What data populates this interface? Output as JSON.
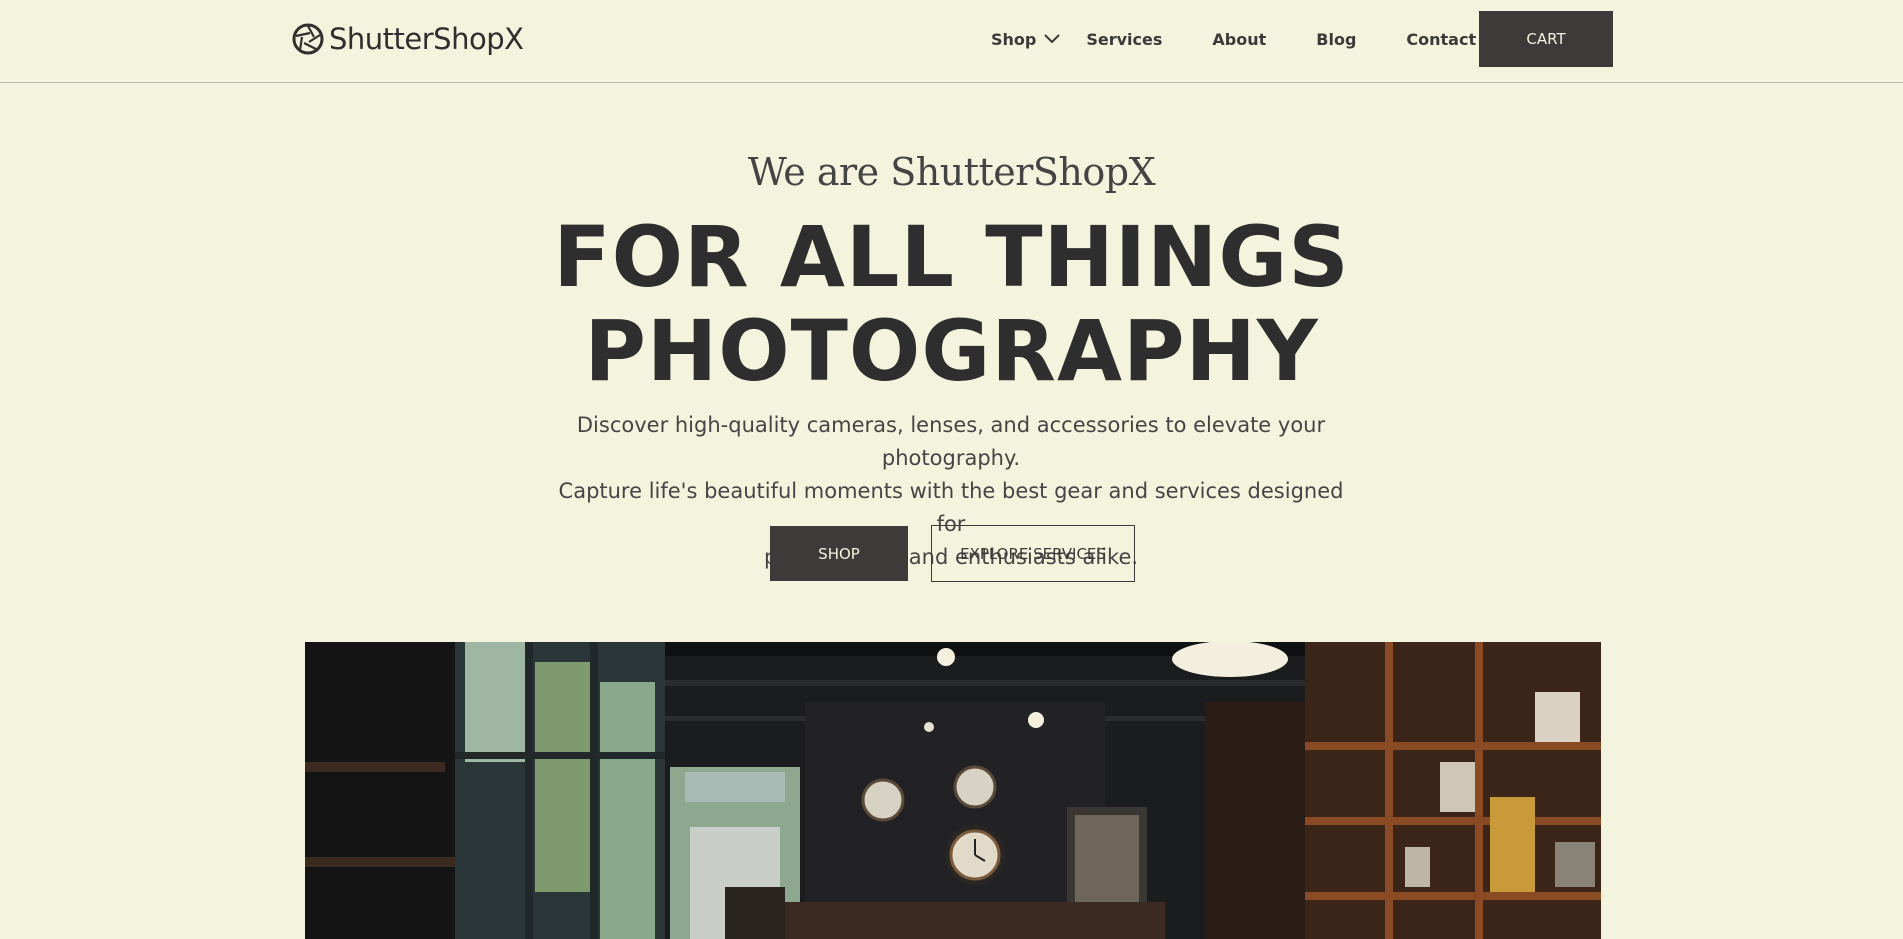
{
  "brand": {
    "name": "ShutterShopX",
    "logo_icon": "aperture-icon"
  },
  "nav": {
    "items": [
      {
        "label": "Shop",
        "has_dropdown": true
      },
      {
        "label": "Services"
      },
      {
        "label": "About"
      },
      {
        "label": "Blog"
      },
      {
        "label": "Contact"
      }
    ],
    "cart_label": "CART"
  },
  "hero": {
    "kicker": "We are ShutterShopX",
    "title_line1": "FOR ALL THINGS",
    "title_line2": "PHOTOGRAPHY",
    "description_line1": "Discover high-quality cameras, lenses, and accessories to elevate your photography.",
    "description_line2": "Capture life's beautiful moments with the best gear and services designed for",
    "description_line3": "professionals and enthusiasts alike.",
    "primary_button": "SHOP",
    "secondary_button": "EXPLORE SERVICES"
  },
  "colors": {
    "background": "#f4f3dd",
    "text_dark": "#2e2e2e",
    "button_dark": "#3d3b3a"
  }
}
